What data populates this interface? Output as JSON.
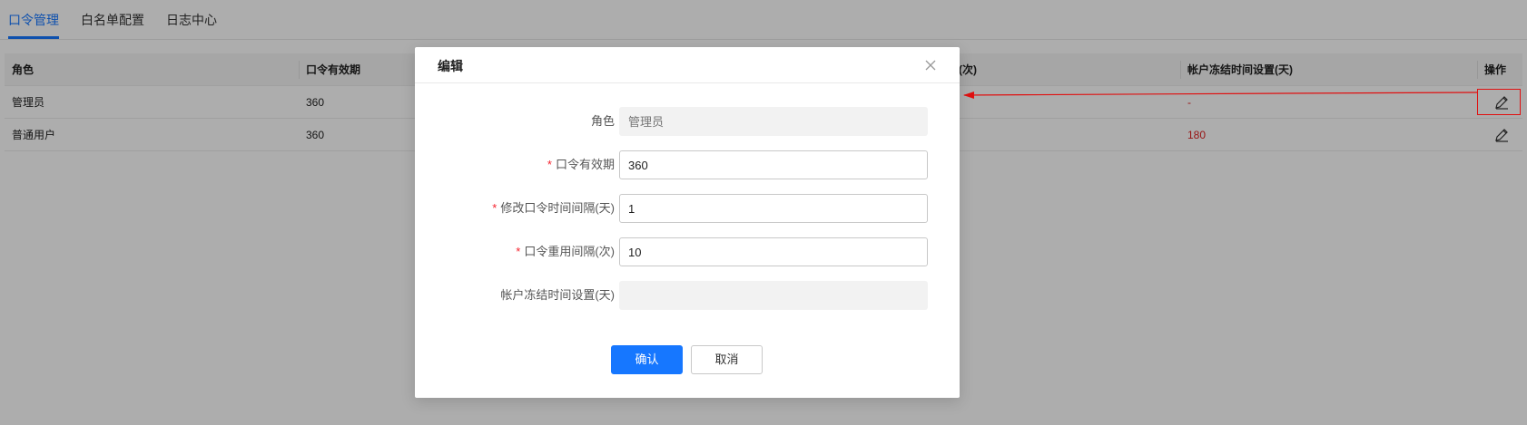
{
  "tabs": [
    {
      "label": "口令管理",
      "active": true
    },
    {
      "label": "白名单配置",
      "active": false
    },
    {
      "label": "日志中心",
      "active": false
    }
  ],
  "table": {
    "headers": {
      "role": "角色",
      "validity": "口令有效期",
      "reuse": "(次)",
      "freeze": "帐户冻结时间设置(天)",
      "action": "操作"
    },
    "rows": [
      {
        "role": "管理员",
        "validity": "360",
        "freeze": "-"
      },
      {
        "role": "普通用户",
        "validity": "360",
        "freeze": "180"
      }
    ]
  },
  "modal": {
    "title": "编辑",
    "fields": [
      {
        "label": "角色",
        "required": false,
        "value": "",
        "placeholder": "管理员",
        "disabled": true
      },
      {
        "label": "口令有效期",
        "required": true,
        "value": "360",
        "placeholder": "",
        "disabled": false
      },
      {
        "label": "修改口令时间间隔(天)",
        "required": true,
        "value": "1",
        "placeholder": "",
        "disabled": false
      },
      {
        "label": "口令重用间隔(次)",
        "required": true,
        "value": "10",
        "placeholder": "",
        "disabled": false
      },
      {
        "label": "帐户冻结时间设置(天)",
        "required": false,
        "value": "",
        "placeholder": "",
        "disabled": true
      }
    ],
    "confirm_label": "确认",
    "cancel_label": "取消",
    "required_mark": "*"
  },
  "icons": {
    "edit": "pencil-icon",
    "close": "close-icon"
  },
  "colors": {
    "accent": "#1677ff",
    "danger": "#e02020",
    "annotation": "#e01010"
  }
}
